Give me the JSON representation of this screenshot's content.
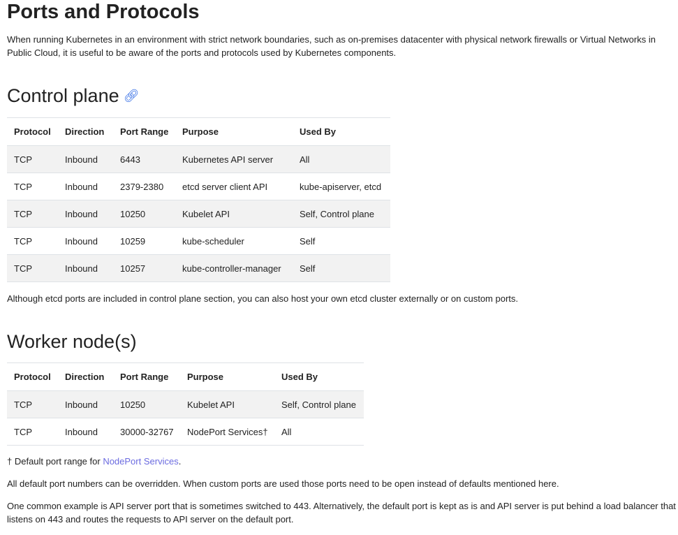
{
  "title": "Ports and Protocols",
  "intro": "When running Kubernetes in an environment with strict network boundaries, such as on-premises datacenter with physical network firewalls or Virtual Networks in Public Cloud, it is useful to be aware of the ports and protocols used by Kubernetes components.",
  "control_plane": {
    "heading": "Control plane",
    "headers": [
      "Protocol",
      "Direction",
      "Port Range",
      "Purpose",
      "Used By"
    ],
    "rows": [
      [
        "TCP",
        "Inbound",
        "6443",
        "Kubernetes API server",
        "All"
      ],
      [
        "TCP",
        "Inbound",
        "2379-2380",
        "etcd server client API",
        "kube-apiserver, etcd"
      ],
      [
        "TCP",
        "Inbound",
        "10250",
        "Kubelet API",
        "Self, Control plane"
      ],
      [
        "TCP",
        "Inbound",
        "10259",
        "kube-scheduler",
        "Self"
      ],
      [
        "TCP",
        "Inbound",
        "10257",
        "kube-controller-manager",
        "Self"
      ]
    ],
    "note": "Although etcd ports are included in control plane section, you can also host your own etcd cluster externally or on custom ports."
  },
  "worker": {
    "heading": "Worker node(s)",
    "headers": [
      "Protocol",
      "Direction",
      "Port Range",
      "Purpose",
      "Used By"
    ],
    "rows": [
      [
        "TCP",
        "Inbound",
        "10250",
        "Kubelet API",
        "Self, Control plane"
      ],
      [
        "TCP",
        "Inbound",
        "30000-32767",
        "NodePort Services†",
        "All"
      ]
    ]
  },
  "footnote": {
    "prefix": "† Default port range for ",
    "link": "NodePort Services",
    "suffix": "."
  },
  "para1": "All default port numbers can be overridden. When custom ports are used those ports need to be open instead of defaults mentioned here.",
  "para2": "One common example is API server port that is sometimes switched to 443. Alternatively, the default port is kept as is and API server is put behind a load balancer that listens on 443 and routes the requests to API server on the default port."
}
